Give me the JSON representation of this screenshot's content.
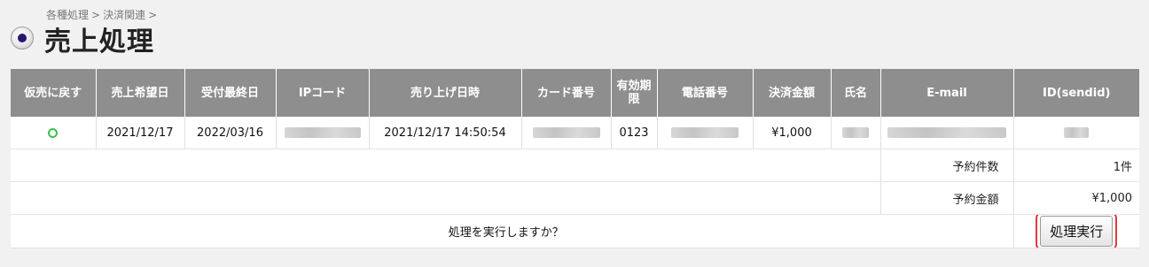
{
  "breadcrumb": [
    "各種処理",
    "決済関連"
  ],
  "breadcrumb_sep": ">",
  "page_title": "売上処理",
  "table": {
    "headers": [
      "仮売に戻す",
      "売上希望日",
      "受付最終日",
      "IPコード",
      "売り上げ日時",
      "カード番号",
      "有効期限",
      "電話番号",
      "決済金額",
      "氏名",
      "E-mail",
      "ID(sendid)"
    ],
    "row": {
      "desired_date": "2021/12/17",
      "deadline": "2022/03/16",
      "sales_datetime": "2021/12/17 14:50:54",
      "expiry": "0123",
      "amount": "¥1,000"
    }
  },
  "summary": {
    "count_label": "予約件数",
    "count_value": "1件",
    "amount_label": "予約金額",
    "amount_value": "¥1,000"
  },
  "action": {
    "confirm_text": "処理を実行しますか？",
    "execute_label": "処理実行"
  },
  "colors": {
    "header_bg": "#8e8e8e",
    "confirm_text": "#c0282d",
    "highlight_border": "#e23a3a",
    "status_circle": "#3fbf4b"
  }
}
